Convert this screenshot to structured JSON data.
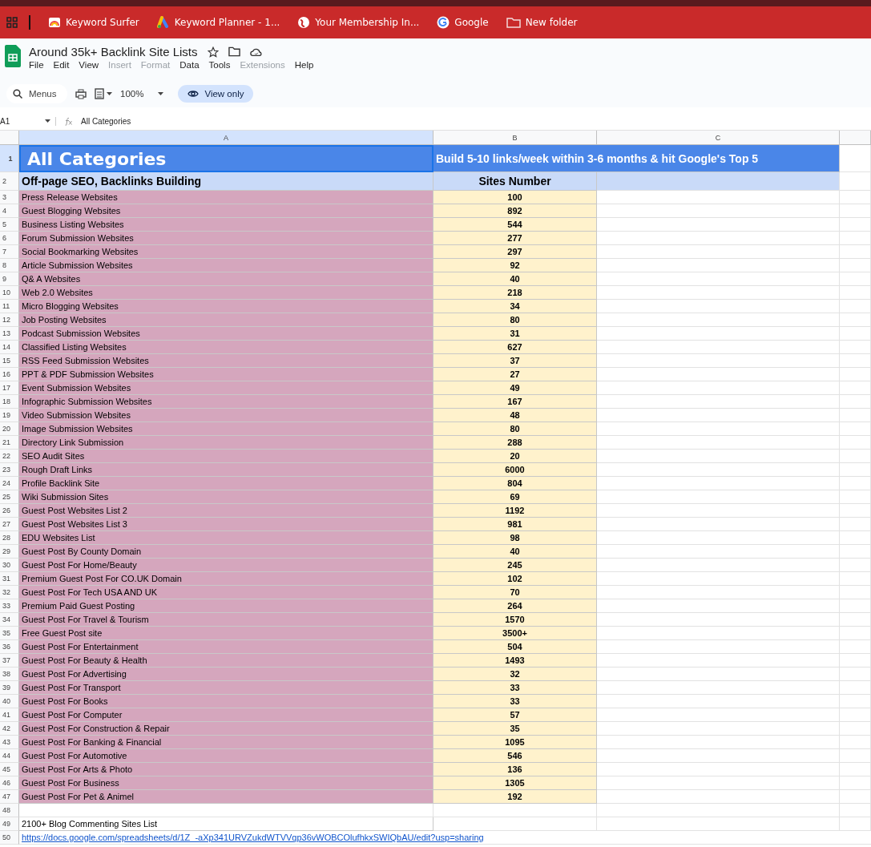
{
  "bookmarks": [
    {
      "label": "Keyword Surfer",
      "kind": "rainbow"
    },
    {
      "label": "Keyword Planner - 1...",
      "kind": "ads"
    },
    {
      "label": "Your Membership In...",
      "kind": "globe"
    },
    {
      "label": "Google",
      "kind": "google"
    },
    {
      "label": "New folder",
      "kind": "folder"
    }
  ],
  "document": {
    "title": "Around 35k+ Backlink Site Lists"
  },
  "menu": [
    {
      "label": "File",
      "disabled": false
    },
    {
      "label": "Edit",
      "disabled": false
    },
    {
      "label": "View",
      "disabled": false
    },
    {
      "label": "Insert",
      "disabled": true
    },
    {
      "label": "Format",
      "disabled": true
    },
    {
      "label": "Data",
      "disabled": false
    },
    {
      "label": "Tools",
      "disabled": false
    },
    {
      "label": "Extensions",
      "disabled": true
    },
    {
      "label": "Help",
      "disabled": false
    }
  ],
  "toolbar": {
    "search_placeholder": "Menus",
    "zoom": "100%",
    "mode": "View only"
  },
  "formula_bar": {
    "cell_ref": "A1",
    "value": "All Categories"
  },
  "columns": [
    "A",
    "B",
    "C"
  ],
  "title_row": {
    "number": "1",
    "title": "All Categories",
    "tagline": "Build 5-10 links/week within 3-6 months & hit Google's Top 5"
  },
  "header_row": {
    "number": "2",
    "category": "Off-page SEO, Backlinks Building",
    "count": "Sites Number"
  },
  "rows": [
    {
      "number": "3",
      "category": "Press Release Websites",
      "count": "100"
    },
    {
      "number": "4",
      "category": "Guest Blogging Websites",
      "count": "892"
    },
    {
      "number": "5",
      "category": "Business Listing Websites",
      "count": "544"
    },
    {
      "number": "6",
      "category": "Forum Submission Websites",
      "count": "277"
    },
    {
      "number": "7",
      "category": "Social Bookmarking Websites",
      "count": "297"
    },
    {
      "number": "8",
      "category": "Article Submission Websites",
      "count": "92"
    },
    {
      "number": "9",
      "category": "Q& A Websites",
      "count": "40"
    },
    {
      "number": "10",
      "category": "Web 2.0 Websites",
      "count": "218"
    },
    {
      "number": "11",
      "category": "Micro Blogging Websites",
      "count": "34"
    },
    {
      "number": "12",
      "category": "Job Posting Websites",
      "count": "80"
    },
    {
      "number": "13",
      "category": "Podcast Submission Websites",
      "count": "31"
    },
    {
      "number": "14",
      "category": "Classified Listing Websites",
      "count": "627"
    },
    {
      "number": "15",
      "category": "RSS Feed Submission Websites",
      "count": "37"
    },
    {
      "number": "16",
      "category": "PPT & PDF Submission Websites",
      "count": "27"
    },
    {
      "number": "17",
      "category": "Event Submission Websites",
      "count": "49"
    },
    {
      "number": "18",
      "category": "Infographic Submission Websites",
      "count": "167"
    },
    {
      "number": "19",
      "category": "Video Submission Websites",
      "count": "48"
    },
    {
      "number": "20",
      "category": "Image Submission Websites",
      "count": "80"
    },
    {
      "number": "21",
      "category": "Directory Link Submission",
      "count": "288"
    },
    {
      "number": "22",
      "category": "SEO Audit Sites",
      "count": "20"
    },
    {
      "number": "23",
      "category": "Rough Draft Links",
      "count": "6000"
    },
    {
      "number": "24",
      "category": "Profile Backlink Site",
      "count": "804"
    },
    {
      "number": "25",
      "category": "Wiki Submission Sites",
      "count": "69"
    },
    {
      "number": "26",
      "category": "Guest Post Websites List 2",
      "count": "1192"
    },
    {
      "number": "27",
      "category": "Guest Post Websites List 3",
      "count": "981"
    },
    {
      "number": "28",
      "category": "EDU Websites  List",
      "count": "98"
    },
    {
      "number": "29",
      "category": "Guest Post By County Domain",
      "count": "40"
    },
    {
      "number": "30",
      "category": "Guest Post For Home/Beauty",
      "count": "245"
    },
    {
      "number": "31",
      "category": "Premium Guest Post For CO.UK Domain",
      "count": "102"
    },
    {
      "number": "32",
      "category": "Guest Post For Tech USA AND UK",
      "count": "70"
    },
    {
      "number": "33",
      "category": "Premium Paid Guest Posting",
      "count": "264"
    },
    {
      "number": "34",
      "category": "Guest Post For Travel & Tourism",
      "count": "1570"
    },
    {
      "number": "35",
      "category": "Free Guest Post site",
      "count": "3500+"
    },
    {
      "number": "36",
      "category": "Guest Post For Entertainment",
      "count": "504"
    },
    {
      "number": "37",
      "category": "Guest Post For Beauty & Health",
      "count": "1493"
    },
    {
      "number": "38",
      "category": "Guest Post For Advertising",
      "count": "32"
    },
    {
      "number": "39",
      "category": "Guest Post For Transport",
      "count": "33"
    },
    {
      "number": "40",
      "category": "Guest Post For Books",
      "count": "33"
    },
    {
      "number": "41",
      "category": "Guest Post For Computer",
      "count": "57"
    },
    {
      "number": "42",
      "category": "Guest Post For Construction & Repair",
      "count": "35"
    },
    {
      "number": "43",
      "category": "Guest Post For Banking & Financial",
      "count": "1095"
    },
    {
      "number": "44",
      "category": "Guest Post For Automotive",
      "count": "546"
    },
    {
      "number": "45",
      "category": "Guest Post For Arts & Photo",
      "count": "136"
    },
    {
      "number": "46",
      "category": "Guest Post For Business",
      "count": "1305"
    },
    {
      "number": "47",
      "category": "Guest Post For Pet & Animel",
      "count": "192"
    }
  ],
  "extra_rows": [
    {
      "number": "48",
      "kind": "empty"
    },
    {
      "number": "49",
      "kind": "text",
      "text": "2100+ Blog Commenting Sites List"
    },
    {
      "number": "50",
      "kind": "link",
      "text": "https://docs.google.com/spreadsheets/d/1Z_-aXp341URVZukdWTVVqp36vWOBCOlufhkxSWIQbAU/edit?usp=sharing"
    }
  ]
}
